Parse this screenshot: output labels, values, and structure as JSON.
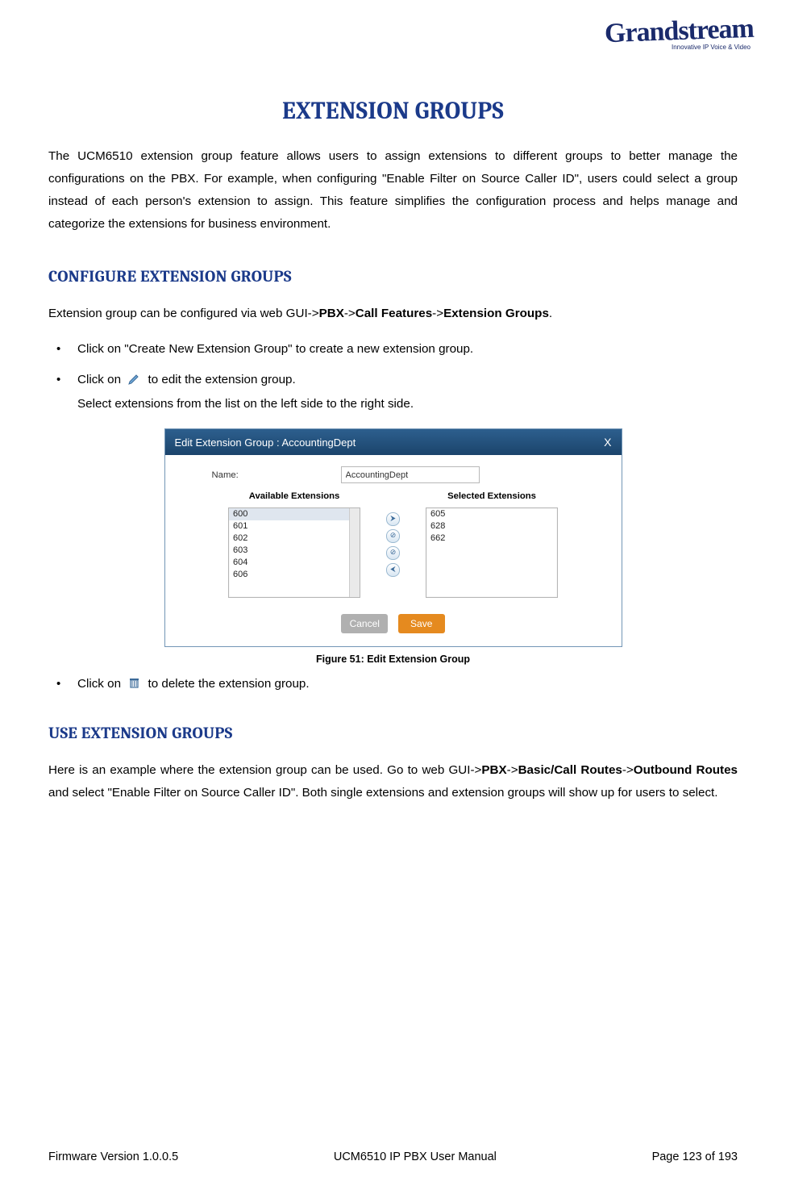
{
  "logo": {
    "script": "Grandstream",
    "sub": "Innovative IP Voice & Video"
  },
  "title": "EXTENSION GROUPS",
  "intro": {
    "text": "The UCM6510 extension group feature allows users to assign extensions to different groups to better manage the configurations on the PBX. For example, when configuring \"Enable Filter on Source Caller ID\", users could select a group instead of each person's extension to assign. This feature simplifies the configuration process and helps manage and categorize the extensions for business environment."
  },
  "section_configure": {
    "heading": "CONFIGURE EXTENSION GROUPS",
    "lead_prefix": "Extension group can be configured via web GUI->",
    "path_pbx": "PBX",
    "sep1": "->",
    "path_cf": "Call Features",
    "sep2": "->",
    "path_eg": "Extension Groups",
    "lead_suffix": ".",
    "bullet1": "Click on \"Create New Extension Group\" to create a new extension group.",
    "bullet2_prefix": "Click on ",
    "bullet2_suffix": " to edit the extension group.",
    "bullet2_sub": "Select extensions from the list on the left side to the right side.",
    "bullet3_prefix": "Click on ",
    "bullet3_suffix": " to delete the extension group."
  },
  "dialog": {
    "title": "Edit Extension Group : AccountingDept",
    "close": "X",
    "name_label": "Name:",
    "name_value": "AccountingDept",
    "avail_hdr": "Available Extensions",
    "selected_hdr": "Selected Extensions",
    "avail": [
      "600",
      "601",
      "602",
      "603",
      "604",
      "606"
    ],
    "selected": [
      "605",
      "628",
      "662"
    ],
    "move_btns": [
      "⮞",
      "⊘",
      "⊘",
      "⮜"
    ],
    "cancel": "Cancel",
    "save": "Save"
  },
  "caption": "Figure 51: Edit Extension Group",
  "section_use": {
    "heading": "USE EXTENSION GROUPS",
    "text_prefix": "Here is an example where the extension group can be used. Go to web GUI->",
    "p_pbx": "PBX",
    "s1": "->",
    "p_basic": "Basic/Call Routes",
    "s2": "->",
    "p_out": "Outbound Routes",
    "text_suffix": " and select \"Enable Filter on Source Caller ID\". Both single extensions and extension groups will show up for users to select."
  },
  "footer": {
    "left": "Firmware Version 1.0.0.5",
    "center": "UCM6510 IP PBX User Manual",
    "right": "Page 123 of 193"
  }
}
